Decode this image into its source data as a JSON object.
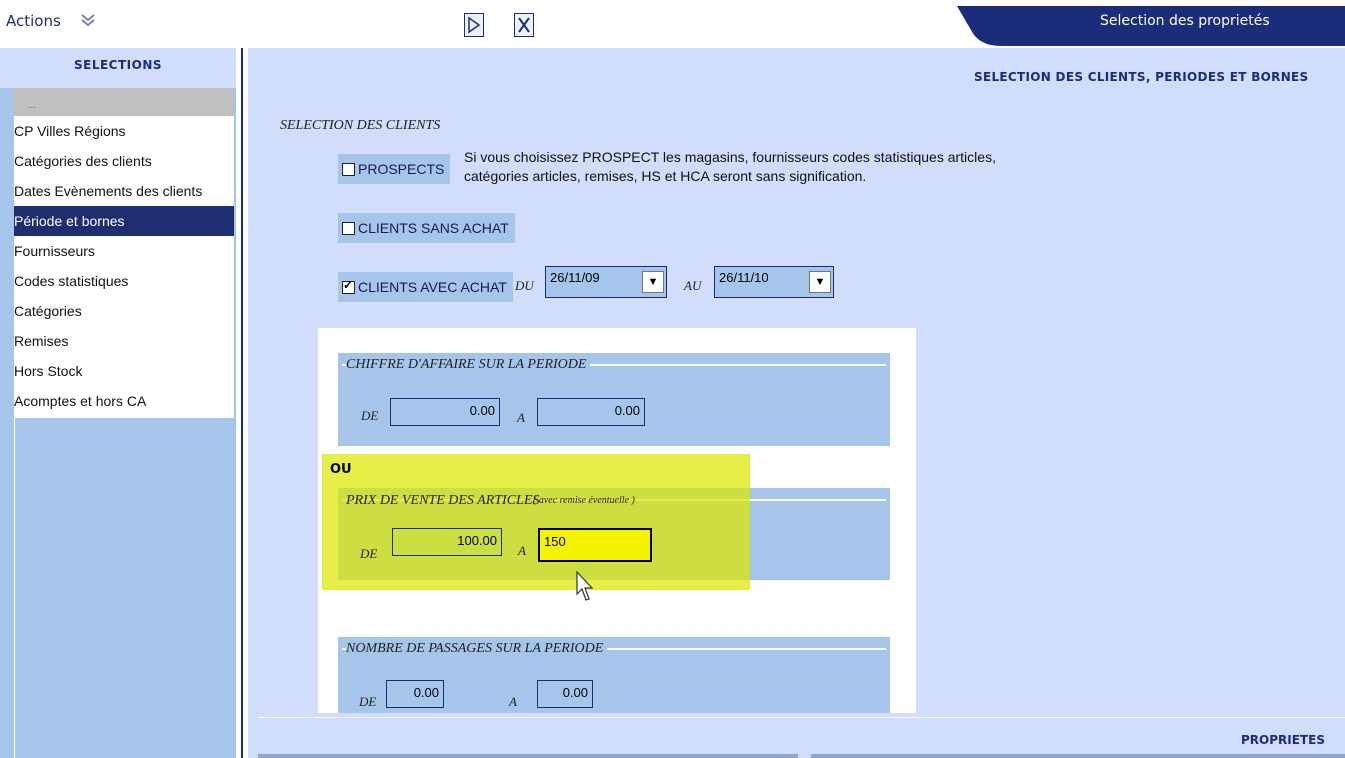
{
  "toolbar": {
    "actions_label": "Actions",
    "title_tab": "Selection des proprietés"
  },
  "left_panel": {
    "header": "SELECTIONS",
    "top_item": "...",
    "items": [
      {
        "label": "CP Villes Régions",
        "selected": false
      },
      {
        "label": "Catégories des clients",
        "selected": false
      },
      {
        "label": "Dates Evènements des clients",
        "selected": false
      },
      {
        "label": "Période et bornes",
        "selected": true
      },
      {
        "label": "Fournisseurs",
        "selected": false
      },
      {
        "label": "Codes statistiques",
        "selected": false
      },
      {
        "label": "Catégories",
        "selected": false
      },
      {
        "label": "Remises",
        "selected": false
      },
      {
        "label": "Hors Stock",
        "selected": false
      },
      {
        "label": "Acomptes et hors CA",
        "selected": false
      }
    ]
  },
  "main": {
    "heading": "SELECTION DES CLIENTS, PERIODES ET BORNES",
    "clients_section_title": "SELECTION DES CLIENTS",
    "prospects": {
      "label": "PROSPECTS",
      "checked": false
    },
    "prospects_note": "Si vous choisissez  PROSPECT les magasins, fournisseurs codes statistiques articles,  catégories articles, remises, HS et HCA seront sans signification.",
    "clients_sans_achat": {
      "label": "CLIENTS SANS ACHAT",
      "checked": false
    },
    "clients_avec_achat": {
      "label": "CLIENTS AVEC ACHAT",
      "checked": true
    },
    "du_label": "DU",
    "date_from": "26/11/09",
    "au_label": "AU",
    "date_to": "26/11/10",
    "ca_periode": {
      "title": "CHIFFRE D'AFFAIRE SUR LA PERIODE",
      "de_label": "DE",
      "de_value": "0.00",
      "a_label": "A",
      "a_value": "0.00"
    },
    "ou_label": "OU",
    "prix_vente": {
      "title": "PRIX DE VENTE DES ARTICLES",
      "title_note": "( avec remise éventuelle )",
      "de_label": "DE",
      "de_value": "100.00",
      "a_label": "A",
      "a_value": "150"
    },
    "passages": {
      "title": "NOMBRE DE PASSAGES SUR LA PERIODE",
      "de_label": "DE",
      "de_value": "0.00",
      "a_label": "A",
      "a_value": "0.00"
    }
  },
  "bottom": {
    "proprietes_label": "PROPRIETES"
  },
  "colors": {
    "navy": "#1b2d7a",
    "panel_blue": "#a6c5ea",
    "main_bg": "#d2dcfb",
    "selected_item": "#1f2e6e",
    "highlight": "#dce800"
  }
}
